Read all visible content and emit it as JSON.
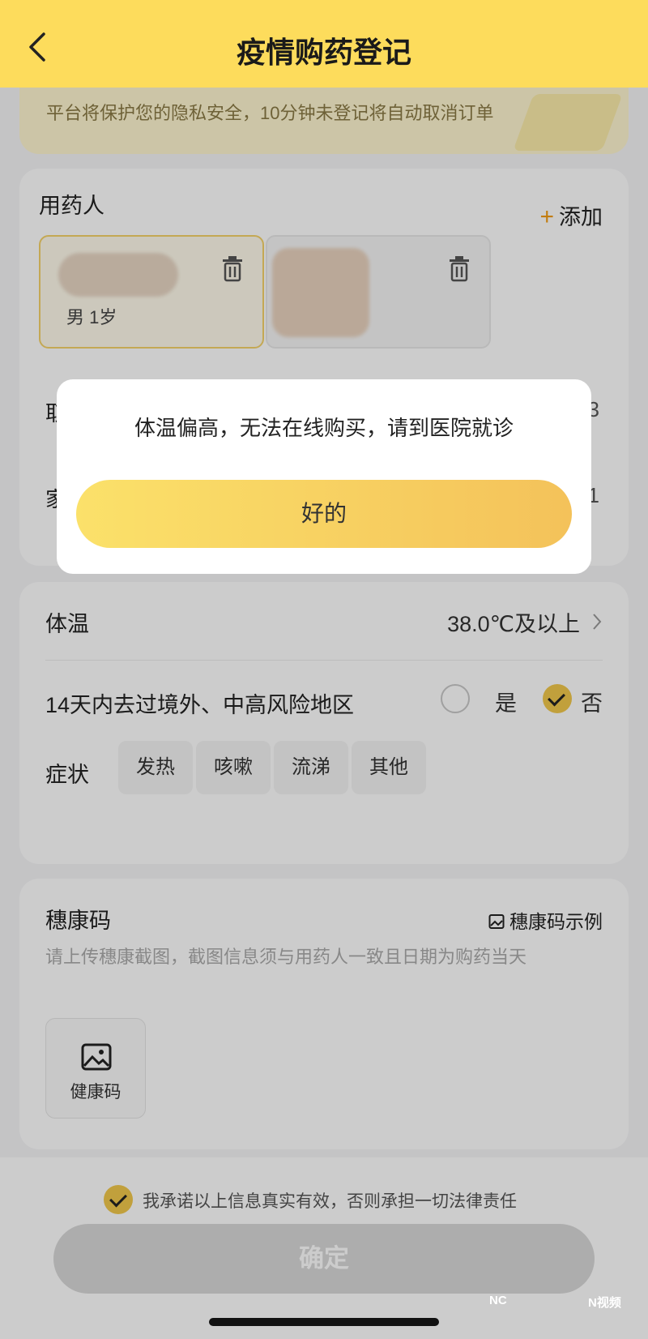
{
  "header": {
    "title": "疫情购药登记"
  },
  "notice": {
    "text": "平台将保护您的隐私安全，10分钟未登记将自动取消订单"
  },
  "medicine_user": {
    "label": "用药人",
    "add_label": "添加",
    "persons": [
      {
        "info": "男 1岁",
        "selected": true
      },
      {
        "info": "",
        "selected": false
      }
    ]
  },
  "partially_hidden": {
    "row1_value": "3",
    "row2_value": "1"
  },
  "health": {
    "temperature_label": "体温",
    "temperature_value": "38.0℃及以上",
    "travel_label": "14天内去过境外、中高风险地区",
    "travel_yes": "是",
    "travel_no": "否",
    "travel_selected": "否",
    "symptom_label": "症状",
    "symptoms": [
      "发热",
      "咳嗽",
      "流涕",
      "其他"
    ]
  },
  "health_code": {
    "label": "穗康码",
    "example_label": "穗康码示例",
    "hint": "请上传穗康截图，截图信息须与用药人一致且日期为购药当天",
    "upload_label": "健康码"
  },
  "agreement": {
    "text": "我承诺以上信息真实有效，否则承担一切法律责任",
    "checked": true
  },
  "confirm_label": "确定",
  "watermark": {
    "left": "NC",
    "right": "N视频"
  },
  "modal": {
    "message": "体温偏高，无法在线购买，请到医院就诊",
    "button_label": "好的"
  },
  "colors": {
    "brand_yellow": "#fddc5c",
    "accent": "#f2c94c"
  }
}
